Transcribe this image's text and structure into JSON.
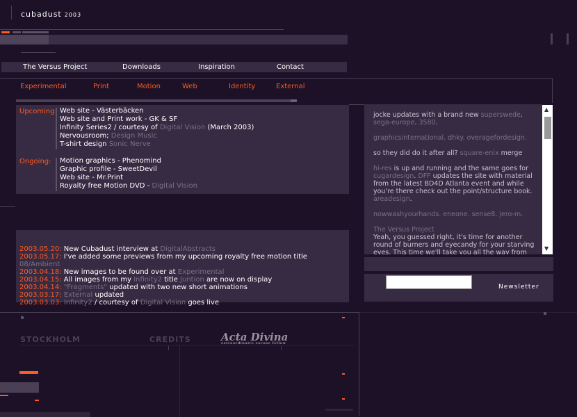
{
  "logo": {
    "name": "cubadust",
    "year": "2003"
  },
  "nav_primary": [
    "The Versus Project",
    "Downloads",
    "Inspiration",
    "Contact"
  ],
  "nav_secondary": [
    "Experimental",
    "Print",
    "Motion",
    "Web",
    "Identity",
    "External"
  ],
  "upcoming": {
    "label": "Upcoming:",
    "items": [
      {
        "text": "Web site - Västerbäcken",
        "extra": ""
      },
      {
        "text": "Web site and Print work - GK & SF",
        "extra": ""
      },
      {
        "text": "Infinity Series2 / courtesy of ",
        "extra": "Digital Vision",
        "suffix": " (March 2003)"
      },
      {
        "text": "Nervousroom; ",
        "extra": "Design Music"
      },
      {
        "text": "T-shirt design ",
        "extra": "Sonic Nerve"
      }
    ]
  },
  "ongoing": {
    "label": "Ongoing:",
    "items": [
      {
        "text": "Motion graphics - Phenomind",
        "extra": ""
      },
      {
        "text": "Graphic profile - SweetDevil",
        "extra": ""
      },
      {
        "text": "Web site - Mr.Print",
        "extra": ""
      },
      {
        "text": "Royalty free Motion DVD - ",
        "extra": "Digital Vision"
      }
    ]
  },
  "news": [
    {
      "date": "2003.05.20:",
      "text": " New Cubadust interview at ",
      "link": "DigitalAbstracts",
      "after": ""
    },
    {
      "date": "2003.05.17:",
      "text": " I've added some previews from my upcoming royalty free motion title ",
      "link": "08/Ambient",
      "after": ""
    },
    {
      "date": "2003.04.18:",
      "text": " New images to be found over at ",
      "link": "Experimental",
      "after": ""
    },
    {
      "date": "2003.04.15:",
      "text": " All images from my ",
      "link": "Infinity2",
      "after": " title ",
      "link2": "Juntion",
      "after2": " are now on display"
    },
    {
      "date": "2003.04.14:",
      "text": " ",
      "link": "\"Fragments\"",
      "after": " updated with two new short animations"
    },
    {
      "date": "2003.03.17:",
      "text": " ",
      "link": "External",
      "after": " updated"
    },
    {
      "date": "2003.03.03:",
      "text": " ",
      "link": "Infinity2",
      "after": " / courtesy of ",
      "link2": "Digital Vision",
      "after2": " goes live"
    }
  ],
  "side": [
    {
      "parts": [
        {
          "t": "jocke updates with a brand new ",
          "c": "plain"
        },
        {
          "t": "superswede",
          "c": "link"
        },
        {
          "t": ". ",
          "c": "plain"
        },
        {
          "t": "sega-europe",
          "c": "link"
        },
        {
          "t": ". ",
          "c": "plain"
        },
        {
          "t": "3580",
          "c": "link"
        },
        {
          "t": ".",
          "c": "plain"
        }
      ]
    },
    {
      "parts": [
        {
          "t": "graphicsinternational. dhky. overagefordesign.",
          "c": "link"
        }
      ]
    },
    {
      "parts": [
        {
          "t": "so they did do it after all? ",
          "c": "plain"
        },
        {
          "t": "square-enix",
          "c": "link"
        },
        {
          "t": " merge",
          "c": "plain"
        }
      ]
    },
    {
      "parts": [
        {
          "t": "hi-res",
          "c": "link"
        },
        {
          "t": " is up and running and the same goes for ",
          "c": "plain"
        },
        {
          "t": "cugardesign",
          "c": "link"
        },
        {
          "t": ". ",
          "c": "plain"
        },
        {
          "t": "DFF",
          "c": "link"
        },
        {
          "t": " updates the site with material from the latest BD4D Atlanta event and while you're there check out the point/structure book. ",
          "c": "plain"
        },
        {
          "t": "areadesign",
          "c": "link"
        },
        {
          "t": ".",
          "c": "plain"
        }
      ]
    },
    {
      "parts": [
        {
          "t": "nowwashyourhands. eneone. sense8. jero-m.",
          "c": "link"
        }
      ]
    },
    {
      "parts": [
        {
          "t": "The Versus Project",
          "c": "link"
        },
        {
          "t": "\nYeah, you guessed right, it's time for another round of burners and eyecandy for your starving eyes. This time we'll take you all the way from Atlanta",
          "c": "plain"
        }
      ]
    }
  ],
  "newsletter": {
    "label": "Newsletter",
    "value": ""
  },
  "footer": {
    "stockholm": "STOCKHOLM",
    "credits": "CREDITS",
    "acta": "Acta Divina",
    "acta_sub": "extraordinaire excuse fellow"
  },
  "colors": {
    "bg": "#1c1126",
    "panel": "#372b43",
    "accent": "#ff5a1f",
    "muted": "#7a7084"
  }
}
